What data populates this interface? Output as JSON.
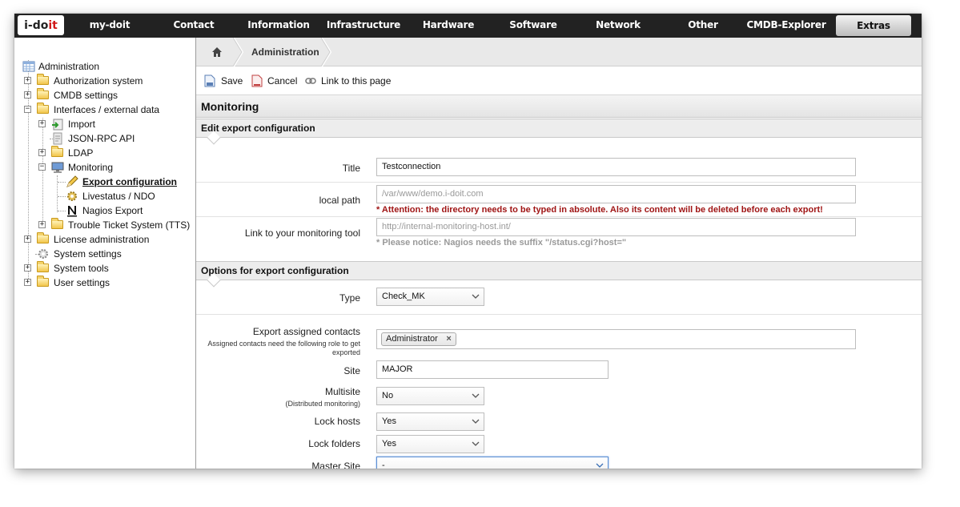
{
  "logo": {
    "text_main": "i-do",
    "text_accent": "it"
  },
  "topnav": {
    "items": [
      {
        "label": "my-doit"
      },
      {
        "label": "Contact"
      },
      {
        "label": "Information"
      },
      {
        "label": "Infrastructure"
      },
      {
        "label": "Hardware"
      },
      {
        "label": "Software"
      },
      {
        "label": "Network"
      },
      {
        "label": "Other"
      },
      {
        "label": "CMDB-Explorer"
      },
      {
        "label": "Extras"
      }
    ],
    "active": "Extras"
  },
  "sidebar": {
    "root": "Administration",
    "items": [
      {
        "label": "Authorization system"
      },
      {
        "label": "CMDB settings"
      },
      {
        "label": "Interfaces / external data"
      },
      {
        "label": "Import"
      },
      {
        "label": "JSON-RPC API"
      },
      {
        "label": "LDAP"
      },
      {
        "label": "Monitoring"
      },
      {
        "label": "Export configuration"
      },
      {
        "label": "Livestatus / NDO"
      },
      {
        "label": "Nagios Export"
      },
      {
        "label": "Trouble Ticket System (TTS)"
      },
      {
        "label": "License administration"
      },
      {
        "label": "System settings"
      },
      {
        "label": "System tools"
      },
      {
        "label": "User settings"
      }
    ]
  },
  "breadcrumb": {
    "label": "Administration"
  },
  "toolbar": {
    "save": "Save",
    "cancel": "Cancel",
    "link": "Link to this page"
  },
  "page": {
    "title": "Monitoring"
  },
  "section1": {
    "title": "Edit export configuration",
    "title_label": "Title",
    "title_value": "Testconnection",
    "path_label": "local path",
    "path_placeholder": "/var/www/demo.i-doit.com",
    "path_warning": "* Attention: the directory needs to be typed in absolute. Also its content will be deleted before each export!",
    "link_label": "Link to your monitoring tool",
    "link_placeholder": "http://internal-monitoring-host.int/",
    "link_notice": "* Please notice: Nagios needs the suffix \"/status.cgi?host=\""
  },
  "section2": {
    "title": "Options for export configuration",
    "type_label": "Type",
    "type_value": "Check_MK",
    "contacts_label": "Export assigned contacts",
    "contacts_sub": "Assigned contacts need the following role to get exported",
    "contacts_tag": "Administrator",
    "contacts_tag_remove": "×",
    "site_label": "Site",
    "site_value": "MAJOR",
    "multisite_label": "Multisite",
    "multisite_sub": "(Distributed monitoring)",
    "multisite_value": "No",
    "lock_hosts_label": "Lock hosts",
    "lock_hosts_value": "Yes",
    "lock_folders_label": "Lock folders",
    "lock_folders_value": "Yes",
    "master_site_label": "Master Site",
    "master_site_value": "-"
  },
  "colors": {
    "nav_bg": "#222222",
    "warning": "#a01515",
    "notice": "#999999",
    "accent": "#d01818"
  }
}
